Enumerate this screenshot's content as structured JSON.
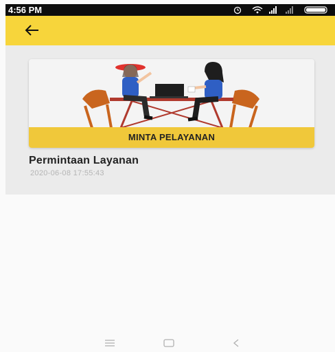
{
  "status_bar": {
    "time": "4:56 PM",
    "icons": [
      "alarm-icon",
      "wifi-icon",
      "signal-icon",
      "signal-icon",
      "battery-icon"
    ]
  },
  "app_bar": {
    "back_icon": "arrow-left-icon",
    "color": "#f7d53b"
  },
  "service_card": {
    "banner_label": "MINTA PELAYANAN",
    "banner_color": "#f0c83a"
  },
  "request": {
    "title": "Permintaan Layanan",
    "timestamp": "2020-06-08 17:55:43"
  },
  "navigation": {
    "icons": [
      "menu-icon",
      "home-icon",
      "back-icon"
    ]
  }
}
